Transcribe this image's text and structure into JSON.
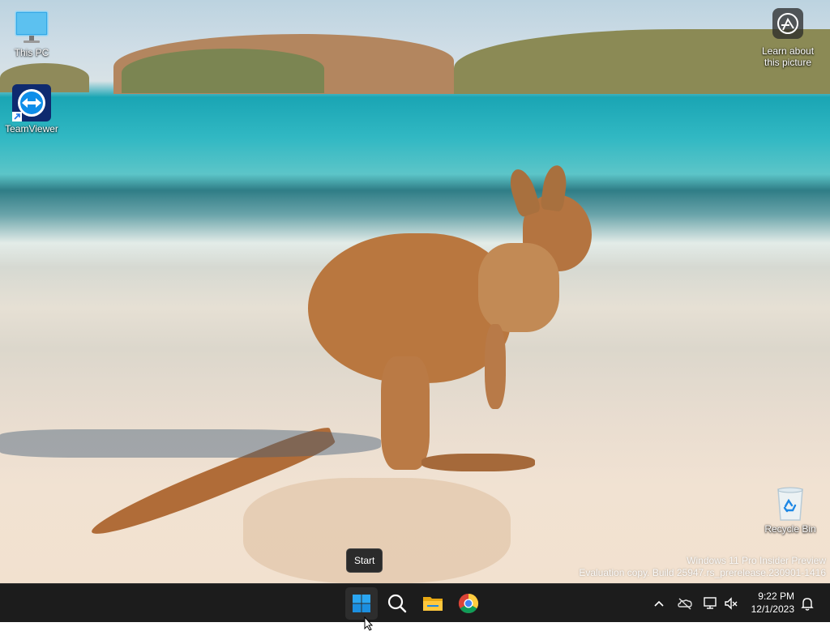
{
  "desktop": {
    "icons": [
      {
        "label": "This PC",
        "icon": "monitor-icon"
      },
      {
        "label": "TeamViewer",
        "icon": "teamviewer-icon"
      },
      {
        "label": "Recycle Bin",
        "icon": "recycle-bin-icon"
      }
    ],
    "learn_about": {
      "line1": "Learn about",
      "line2": "this picture"
    },
    "watermark": {
      "line1": "Windows 11 Pro Insider Preview",
      "line2": "Evaluation copy. Build 25947.rs_prerelease.230901-1416"
    }
  },
  "tooltip": {
    "text": "Start"
  },
  "taskbar": {
    "apps": [
      {
        "name": "start",
        "icon": "windows-logo-icon"
      },
      {
        "name": "search",
        "icon": "search-icon"
      },
      {
        "name": "file-explorer",
        "icon": "folder-icon"
      },
      {
        "name": "chrome",
        "icon": "chrome-icon"
      }
    ],
    "tray": {
      "time": "9:22 PM",
      "date": "12/1/2023",
      "icons": [
        "chevron-up-icon",
        "onedrive-offline-icon",
        "network-icon",
        "volume-muted-icon",
        "bell-icon"
      ]
    }
  },
  "colors": {
    "taskbar_bg": "#1c1c1c",
    "accent_blue": "#0078d4",
    "tooltip_bg": "#2b2b2b"
  }
}
